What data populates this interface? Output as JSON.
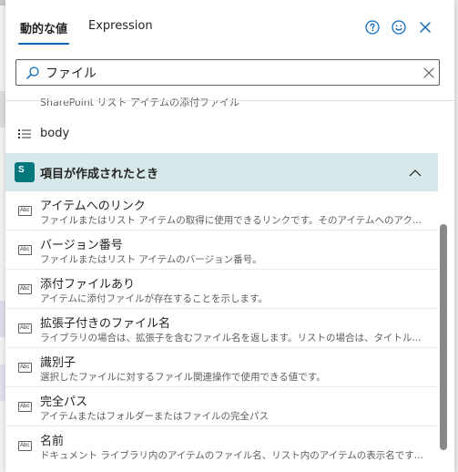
{
  "tabs": [
    {
      "label": "動的な値",
      "active": true
    },
    {
      "label": "Expression",
      "active": false
    }
  ],
  "header_icons": [
    "help-icon",
    "smile-icon",
    "close-icon"
  ],
  "search": {
    "value": "ファイル",
    "placeholder": ""
  },
  "partial_row": {
    "description": "SharePoint リスト アイテムの添付ファイル"
  },
  "body_row": {
    "label": "body",
    "icon": "list-icon"
  },
  "group": {
    "title": "項目が作成されたとき",
    "logo_text": "S",
    "logo_color": "#03787c",
    "expanded": true
  },
  "items": [
    {
      "name": "アイテムへのリンク",
      "desc": "ファイルまたはリスト アイテムの取得に使用できるリンクです。そのアイテムへのアク...",
      "type": "Abc"
    },
    {
      "name": "バージョン番号",
      "desc": "ファイルまたはリスト アイテムのバージョン番号。",
      "type": "Abc"
    },
    {
      "name": "添付ファイルあり",
      "desc": "アイテムに添付ファイルが存在することを示します。",
      "type": "Abc"
    },
    {
      "name": "拡張子付きのファイル名",
      "desc": "ライブラリの場合は、拡張子を含むファイル名を返します。リストの場合は、タイトル...",
      "type": "Abc"
    },
    {
      "name": "識別子",
      "desc": "選択したファイルに対するファイル関連操作で使用できる値です。",
      "type": "Abc"
    },
    {
      "name": "完全パス",
      "desc": "アイテムまたはフォルダーまたはファイルの完全パス",
      "type": "Abc"
    },
    {
      "name": "名前",
      "desc": "ドキュメント ライブラリ内のアイテムのファイル名、リスト内のアイテムの表示名です...",
      "type": "Abc"
    }
  ],
  "colors": {
    "accent": "#0f6cbd",
    "group_bg": "#d6e8ea"
  }
}
